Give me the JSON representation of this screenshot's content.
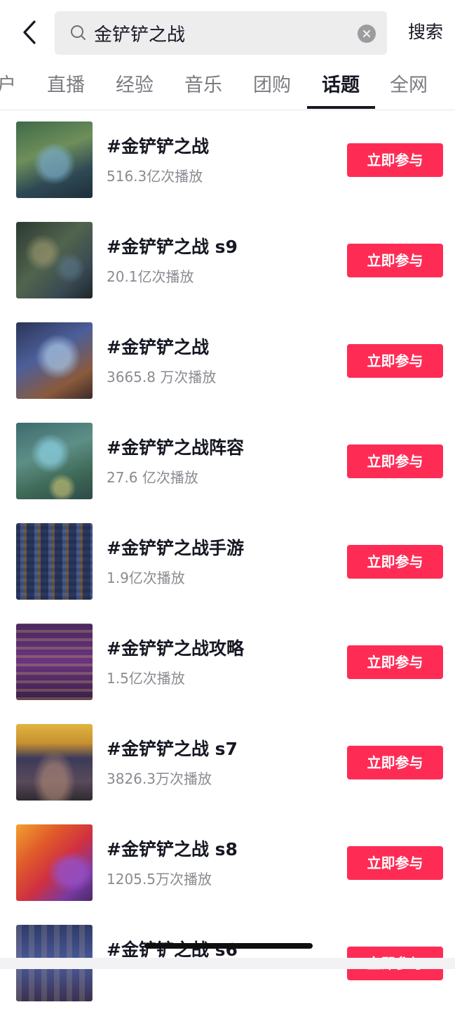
{
  "search": {
    "query": "金铲铲之战",
    "submit_label": "搜索"
  },
  "tabs": [
    {
      "label": "户"
    },
    {
      "label": "直播"
    },
    {
      "label": "经验"
    },
    {
      "label": "音乐"
    },
    {
      "label": "团购"
    },
    {
      "label": "话题",
      "active": true
    },
    {
      "label": "全网"
    }
  ],
  "topics": [
    {
      "title": "#金铲铲之战",
      "views": "516.3亿次播放",
      "button": "立即参与"
    },
    {
      "title": "#金铲铲之战 s9",
      "views": "20.1亿次播放",
      "button": "立即参与"
    },
    {
      "title": "#金铲铲之战",
      "views": "3665.8 万次播放",
      "button": "立即参与"
    },
    {
      "title": "#金铲铲之战阵容",
      "views": "27.6 亿次播放",
      "button": "立即参与"
    },
    {
      "title": "#金铲铲之战手游",
      "views": "1.9亿次播放",
      "button": "立即参与"
    },
    {
      "title": "#金铲铲之战攻略",
      "views": "1.5亿次播放",
      "button": "立即参与"
    },
    {
      "title": "#金铲铲之战 s7",
      "views": "3826.3万次播放",
      "button": "立即参与"
    },
    {
      "title": "#金铲铲之战 s8",
      "views": "1205.5万次播放",
      "button": "立即参与"
    },
    {
      "title": "#金铲铲之战 s6",
      "views": "",
      "button": "立即参与"
    }
  ],
  "colors": {
    "accent": "#fe2c55",
    "text_primary": "#161823",
    "text_secondary": "#8a8b91"
  }
}
